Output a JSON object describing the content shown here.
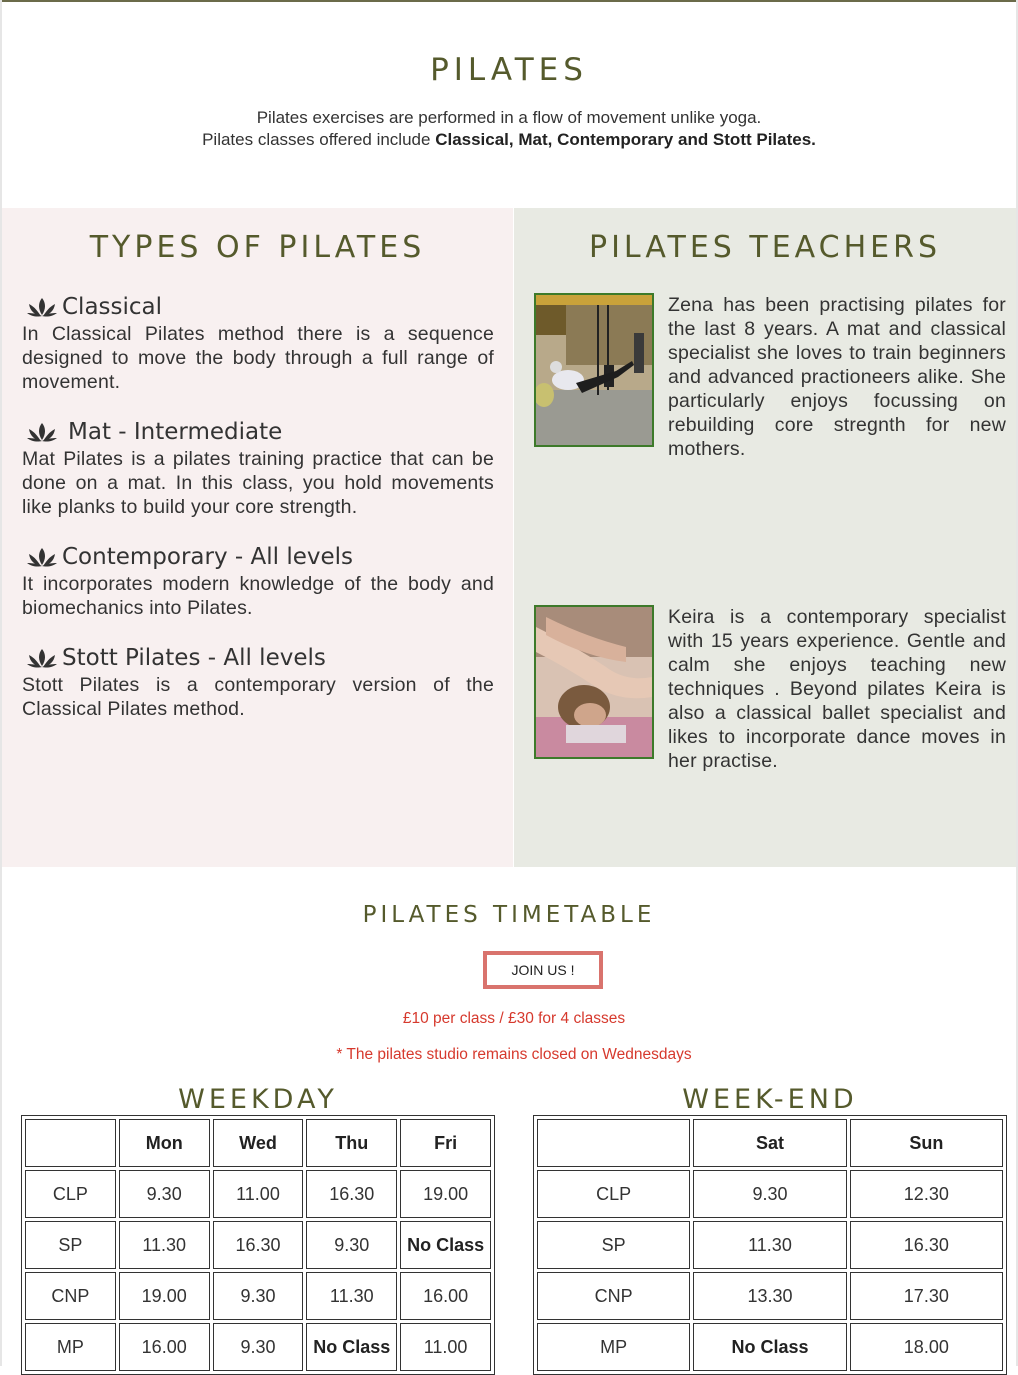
{
  "intro": {
    "title": "PILATES",
    "line1": "Pilates exercises are performed in a flow of movement unlike yoga.",
    "line2_prefix": "Pilates classes offered include ",
    "line2_bold": "Classical, Mat, Contemporary and Stott Pilates."
  },
  "types": {
    "title": "TYPES OF PILATES",
    "items": [
      {
        "icon": "lotus-icon",
        "name": "Classical",
        "desc": "In Classical Pilates method there is a sequence designed to move the body through a full range of movement."
      },
      {
        "icon": "lotus-icon",
        "name": "Mat - Intermediate",
        "desc": "Mat Pilates is a pilates training practice that can be done on a mat. In this class, you hold movements like planks to build your core strength."
      },
      {
        "icon": "lotus-icon",
        "name": "Contemporary - All levels",
        "desc": "It incorporates modern knowledge of the body and biomechanics into Pilates."
      },
      {
        "icon": "lotus-icon",
        "name": "Stott Pilates - All levels",
        "desc": "Stott Pilates is a contemporary version of the Classical Pilates method."
      }
    ]
  },
  "teachers": {
    "title": "PILATES TEACHERS",
    "items": [
      {
        "bio": "Zena has been practising pilates for the last 8 years. A mat and classical specialist she loves to train beginners and advanced practioneers alike. She particularly enjoys focussing on rebuilding core stregnth for new mothers."
      },
      {
        "bio": "Keira is a contemporary specialist with 15 years experience. Gentle and calm she enjoys teaching new techniques . Beyond pilates Keira is also a classical ballet specialist and likes to incorporate dance moves in her practise."
      }
    ]
  },
  "timetable": {
    "title": "PILATES TIMETABLE",
    "join_label": "JOIN US !",
    "price": "£10 per class / £30 for 4 classes",
    "note": "* The pilates studio remains closed on Wednesdays",
    "weekday": {
      "title": "WEEKDAY",
      "headers": [
        "",
        "Mon",
        "Wed",
        "Thu",
        "Fri"
      ],
      "rows": [
        [
          "CLP",
          "9.30",
          "11.00",
          "16.30",
          "19.00"
        ],
        [
          "SP",
          "11.30",
          "16.30",
          "9.30",
          "No Class"
        ],
        [
          "CNP",
          "19.00",
          "9.30",
          "11.30",
          "16.00"
        ],
        [
          "MP",
          "16.00",
          "9.30",
          "No Class",
          "11.00"
        ]
      ]
    },
    "weekend": {
      "title": "WEEK-END",
      "headers": [
        "",
        "Sat",
        "Sun"
      ],
      "rows": [
        [
          "CLP",
          "9.30",
          "12.30"
        ],
        [
          "SP",
          "11.30",
          "16.30"
        ],
        [
          "CNP",
          "13.30",
          "17.30"
        ],
        [
          "MP",
          "No Class",
          "18.00"
        ]
      ]
    }
  },
  "colors": {
    "heading": "#555a2c",
    "types_bg": "#f8f0f0",
    "teachers_bg": "#e8eae3",
    "accent_red": "#d6392d",
    "button_border": "#d9736d"
  }
}
